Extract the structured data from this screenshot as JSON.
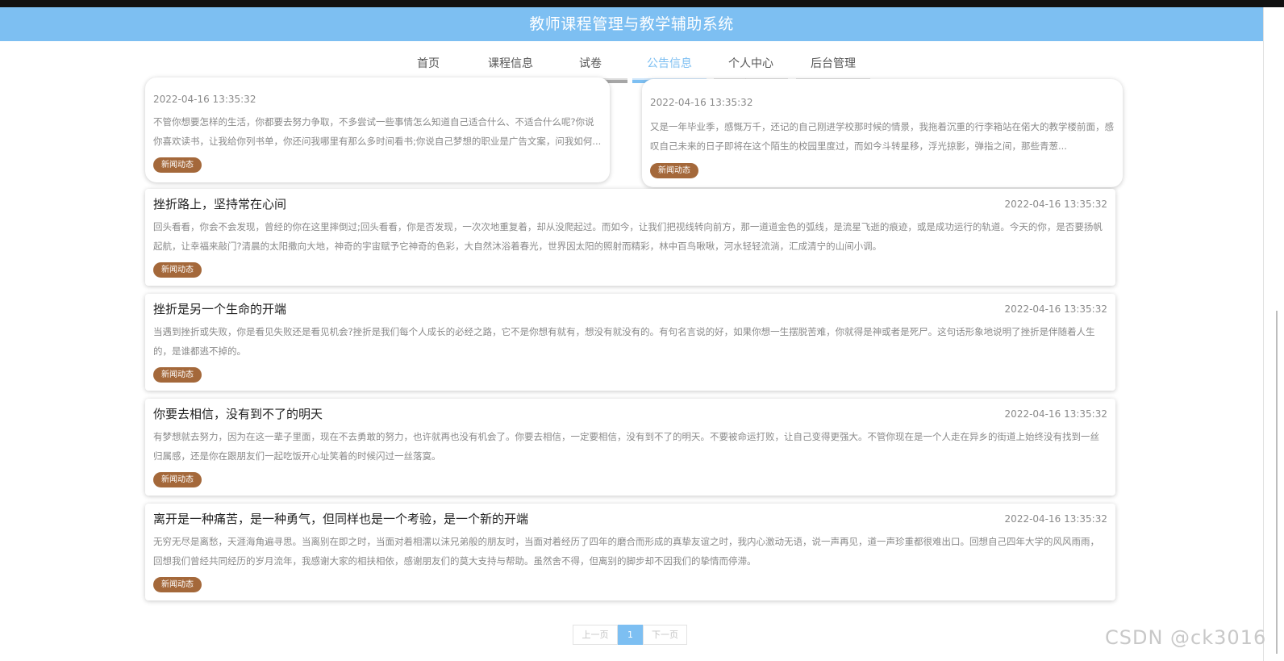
{
  "header": {
    "title": "教师课程管理与教学辅助系统"
  },
  "nav": [
    {
      "label": "首页",
      "active": false
    },
    {
      "label": "课程信息",
      "active": false
    },
    {
      "label": "试卷",
      "active": true
    },
    {
      "label": "公告信息",
      "active": true
    },
    {
      "label": "个人中心",
      "active": false
    },
    {
      "label": "后台管理",
      "active": false
    }
  ],
  "top_cards": [
    {
      "time": "2022-04-16 13:35:32",
      "desc": "不管你想要怎样的生活，你都要去努力争取，不多尝试一些事情怎么知道自己适合什么、不适合什么呢?你说你喜欢读书，让我给你列书单，你还问我哪里有那么多时间看书;你说自己梦想的职业是广告文案，问我如何...",
      "tag": "新闻动态"
    },
    {
      "time": "2022-04-16 13:35:32",
      "desc": "又是一年毕业季，感慨万千，还记的自己刚进学校那时候的情景，我拖着沉重的行李箱站在偌大的教学楼前面，感叹自己未来的日子即将在这个陌生的校园里度过，而如今斗转星移，浮光掠影，弹指之间，那些青葱...",
      "tag": "新闻动态"
    }
  ],
  "list_cards": [
    {
      "title": "挫折路上，坚持常在心间",
      "time": "2022-04-16 13:35:32",
      "desc": "回头看看，你会不会发现，曾经的你在这里摔倒过;回头看看，你是否发现，一次次地重复着，却从没爬起过。而如今，让我们把视线转向前方，那一道道金色的弧线，是流星飞逝的痕迹，或是成功运行的轨道。今天的你，是否要扬帆起航，让幸福来敲门?清晨的太阳撒向大地，神奇的宇宙赋予它神奇的色彩，大自然沐浴着春光，世界因太阳的照射而精彩，林中百鸟啾啾，河水轻轻流淌，汇成清宁的山间小调。",
      "tag": "新闻动态"
    },
    {
      "title": "挫折是另一个生命的开端",
      "time": "2022-04-16 13:35:32",
      "desc": "当遇到挫折或失败，你是看见失败还是看见机会?挫折是我们每个人成长的必经之路，它不是你想有就有，想没有就没有的。有句名言说的好，如果你想一生摆脱苦难，你就得是神或者是死尸。这句话形象地说明了挫折是伴随着人生的，是谁都逃不掉的。",
      "tag": "新闻动态"
    },
    {
      "title": "你要去相信，没有到不了的明天",
      "time": "2022-04-16 13:35:32",
      "desc": "有梦想就去努力，因为在这一辈子里面，现在不去勇敢的努力，也许就再也没有机会了。你要去相信，一定要相信，没有到不了的明天。不要被命运打败，让自己变得更强大。不管你现在是一个人走在异乡的街道上始终没有找到一丝归属感，还是你在跟朋友们一起吃饭开心址笑着的时候闪过一丝落寞。",
      "tag": "新闻动态"
    },
    {
      "title": "离开是一种痛苦，是一种勇气，但同样也是一个考验，是一个新的开端",
      "time": "2022-04-16 13:35:32",
      "desc": "无穷无尽是离愁，天涯海角遍寻思。当离别在即之时，当面对着相濡以沫兄弟般的朋友时，当面对着经历了四年的磨合而形成的真挚友谊之时，我内心激动无语，说一声再见，道一声珍重都很难出口。回想自己四年大学的风风雨雨，回想我们曾经共同经历的岁月流年，我感谢大家的相扶相依，感谢朋友们的莫大支持与帮助。虽然舍不得，但离别的脚步却不因我们的挚情而停滞。",
      "tag": "新闻动态"
    }
  ],
  "pagination": {
    "prev": "上一页",
    "current": "1",
    "next": "下一页"
  },
  "watermark": "CSDN @ck3016",
  "colors": {
    "header_bg": "#7dbff2",
    "tag_bg": "#a4683a",
    "nav_active": "#7dbff2"
  }
}
